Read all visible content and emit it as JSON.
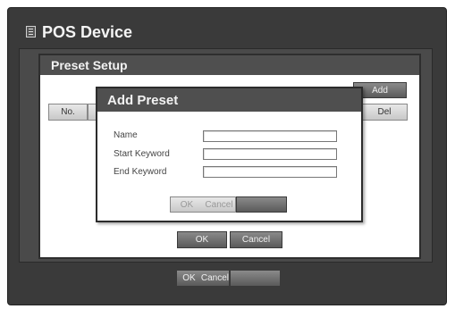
{
  "window": {
    "title": "POS Device"
  },
  "preset_setup": {
    "title": "Preset Setup",
    "column_no": "No.",
    "add_label": "Add",
    "del_label": "Del",
    "ok_label": "OK",
    "cancel_label": "Cancel"
  },
  "add_preset_dialog": {
    "title": "Add Preset",
    "fields": [
      {
        "label": "Name",
        "value": ""
      },
      {
        "label": "Start Keyword",
        "value": ""
      },
      {
        "label": "End Keyword",
        "value": ""
      }
    ],
    "ok_label": "OK",
    "cancel_label": "Cancel"
  },
  "footer": {
    "ok_label": "OK",
    "cancel_label": "Cancel"
  }
}
